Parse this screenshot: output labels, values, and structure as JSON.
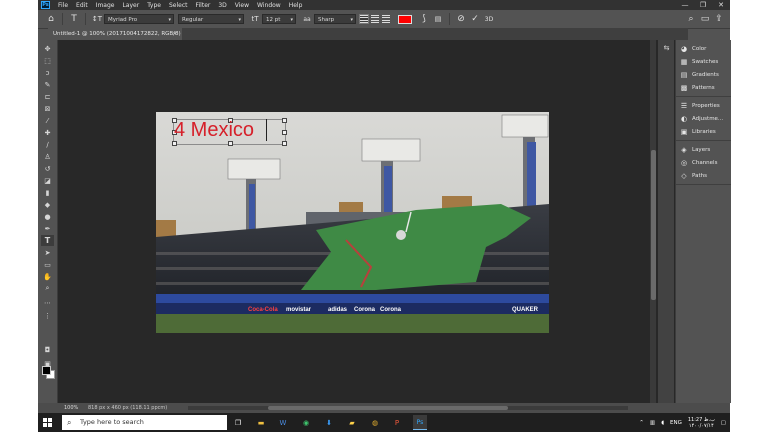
{
  "app": {
    "logo": "Ps",
    "menu": [
      "File",
      "Edit",
      "Image",
      "Layer",
      "Type",
      "Select",
      "Filter",
      "3D",
      "View",
      "Window",
      "Help"
    ],
    "window_controls": {
      "minimize": "—",
      "restore": "❐",
      "close": "✕"
    }
  },
  "options_bar": {
    "font_family": "Myriad Pro",
    "font_style": "Regular",
    "font_size": "12 pt",
    "antialias": "Sharp",
    "text_color": "#ff0000"
  },
  "document": {
    "tab_title": "Untitled-1 @ 100% (20171004172822, RGB/8) *",
    "tab_close": "×",
    "canvas_text": "4 Mexico",
    "text_color": "#d6202a"
  },
  "panels": {
    "group1": [
      "Color",
      "Swatches",
      "Gradients",
      "Patterns"
    ],
    "group2": [
      "Properties",
      "Adjustme...",
      "Libraries"
    ],
    "group3": [
      "Layers",
      "Channels",
      "Paths"
    ]
  },
  "status": {
    "zoom": "100%",
    "doc_size": "818 px x 460 px (118.11 ppcm)"
  },
  "taskbar": {
    "search_placeholder": "Type here to search",
    "language": "ENG",
    "time": "11:27 ب.ظ",
    "date": "۱۴۰۰/۰۷/۱۴"
  }
}
